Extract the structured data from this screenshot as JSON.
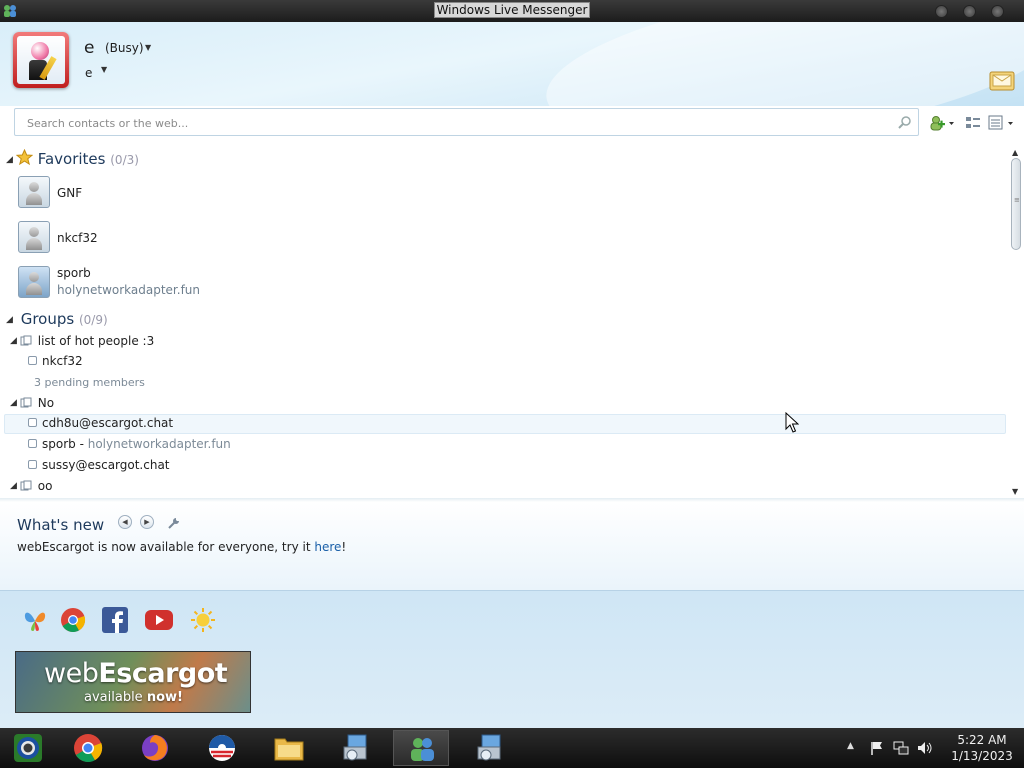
{
  "window": {
    "title": "Windows Live Messenger"
  },
  "profile": {
    "display_name": "e",
    "status": "(Busy)",
    "personal_message": "e"
  },
  "search": {
    "placeholder": "Search contacts or the web..."
  },
  "favorites": {
    "label": "Favorites",
    "count": "(0/3)",
    "contacts": [
      {
        "name": "GNF",
        "sub": ""
      },
      {
        "name": "nkcf32",
        "sub": ""
      },
      {
        "name": "sporb",
        "sub": "holynetworkadapter.fun"
      }
    ]
  },
  "groups": {
    "label": "Groups",
    "count": "(0/9)",
    "items": [
      {
        "name": "list of hot people :3",
        "members": [
          {
            "name": "nkcf32",
            "domain": ""
          }
        ],
        "pending": "3 pending members"
      },
      {
        "name": "No",
        "members": [
          {
            "name": "cdh8u@escargot.chat",
            "domain": ""
          },
          {
            "name": "sporb",
            "domain": "holynetworkadapter.fun",
            "separator": " - "
          },
          {
            "name": "sussy@escargot.chat",
            "domain": ""
          }
        ]
      },
      {
        "name": "oo",
        "members": []
      }
    ]
  },
  "whats_new": {
    "title": "What's new",
    "text": "webEscargot is now available for everyone, try it ",
    "link": "here",
    "after": "!"
  },
  "banner": {
    "brand_light": "web",
    "brand_bold": "Escargot",
    "tagline_pre": "available ",
    "tagline_bold": "now!"
  },
  "services": [
    "messenger-butterfly-icon",
    "chrome-icon",
    "facebook-icon",
    "youtube-icon",
    "weather-sun-icon"
  ],
  "taskbar": {
    "apps": [
      "start-orb-icon",
      "chrome-icon",
      "firefox-icon",
      "obama-logo-icon",
      "file-explorer-icon",
      "installer-icon",
      "messenger-icon",
      "installer-icon"
    ]
  },
  "clock": {
    "time": "5:22 AM",
    "date": "1/13/2023"
  },
  "colors": {
    "header_bg": "#d9eef9",
    "avatar_frame": "#c01e1e",
    "link": "#1a5fa8",
    "taskbar": "#111111"
  }
}
